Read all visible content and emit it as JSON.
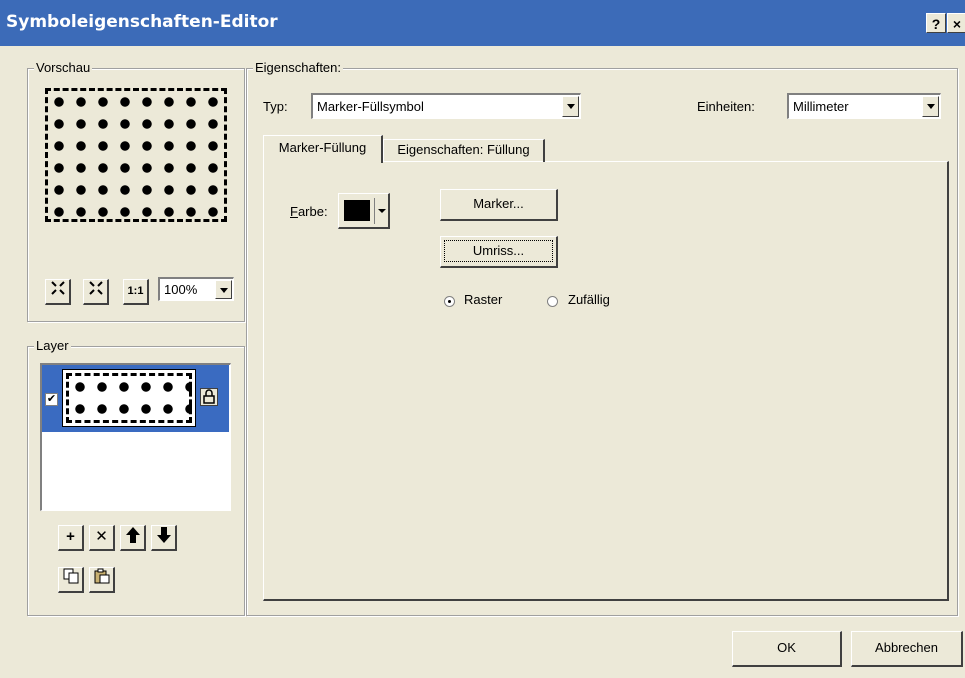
{
  "window": {
    "title": "Symboleigenschaften-Editor",
    "help_btn": "?",
    "close_btn": "×"
  },
  "preview": {
    "group_label": "Vorschau",
    "zoom": "100%",
    "zoom_in_icon": "⁜",
    "fit_icon": "⛶",
    "actual_size_icon": "1:1"
  },
  "layer": {
    "group_label": "Layer",
    "checked": true,
    "buttons": {
      "add": "+",
      "remove": "✕",
      "up": "⬆",
      "down": "⬇",
      "copy": "⧉",
      "paste": "📋"
    }
  },
  "properties": {
    "group_label": "Eigenschaften:",
    "type_label": "Typ:",
    "type_value": "Marker-Füllsymbol",
    "units_label": "Einheiten:",
    "units_value": "Millimeter",
    "tabs": [
      "Marker-Füllung",
      "Eigenschaften: Füllung"
    ],
    "active_tab": 0,
    "color_label_accel": "F",
    "color_label_rest": "arbe:",
    "color_value": "#000000",
    "marker_button": "Marker...",
    "outline_button": "Umriss...",
    "radio_grid": "Raster",
    "radio_random": "Zufällig",
    "selected_radio": "Raster"
  },
  "footer": {
    "ok": "OK",
    "cancel": "Abbrechen"
  }
}
